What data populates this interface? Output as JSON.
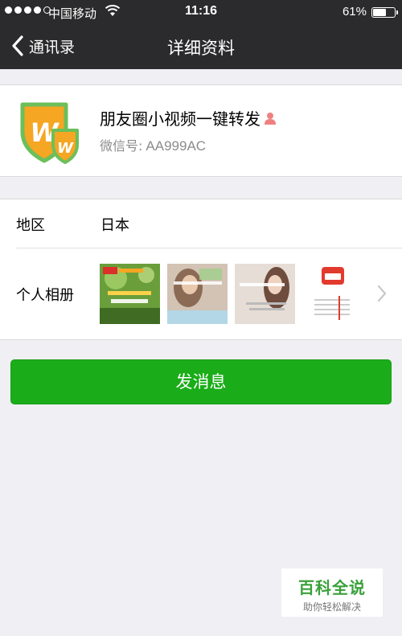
{
  "status_bar": {
    "carrier": "中国移动",
    "time": "11:16",
    "battery_text": "61%",
    "battery_level": 0.61,
    "signal_bars_filled": 4,
    "signal_bars_total": 5
  },
  "nav": {
    "back_label": "通讯录",
    "title": "详细资料"
  },
  "profile": {
    "name": "朋友圈小视频一键转发",
    "wechat_label": "微信号:",
    "wechat_id": "AA999AC",
    "avatar_icon": "shield-logo-icon",
    "contact_icon": "person-icon"
  },
  "region": {
    "label": "地区",
    "value": "日本"
  },
  "album": {
    "label": "个人相册",
    "thumbnails": [
      "album-thumb-1",
      "album-thumb-2",
      "album-thumb-3",
      "album-thumb-4"
    ]
  },
  "actions": {
    "send_message": "发消息"
  },
  "watermark": {
    "title": "百科全说",
    "subtitle": "助你轻松解决"
  },
  "colors": {
    "nav_bg": "#2b2b2d",
    "send_green": "#1aad19",
    "page_bg": "#efeff4"
  }
}
